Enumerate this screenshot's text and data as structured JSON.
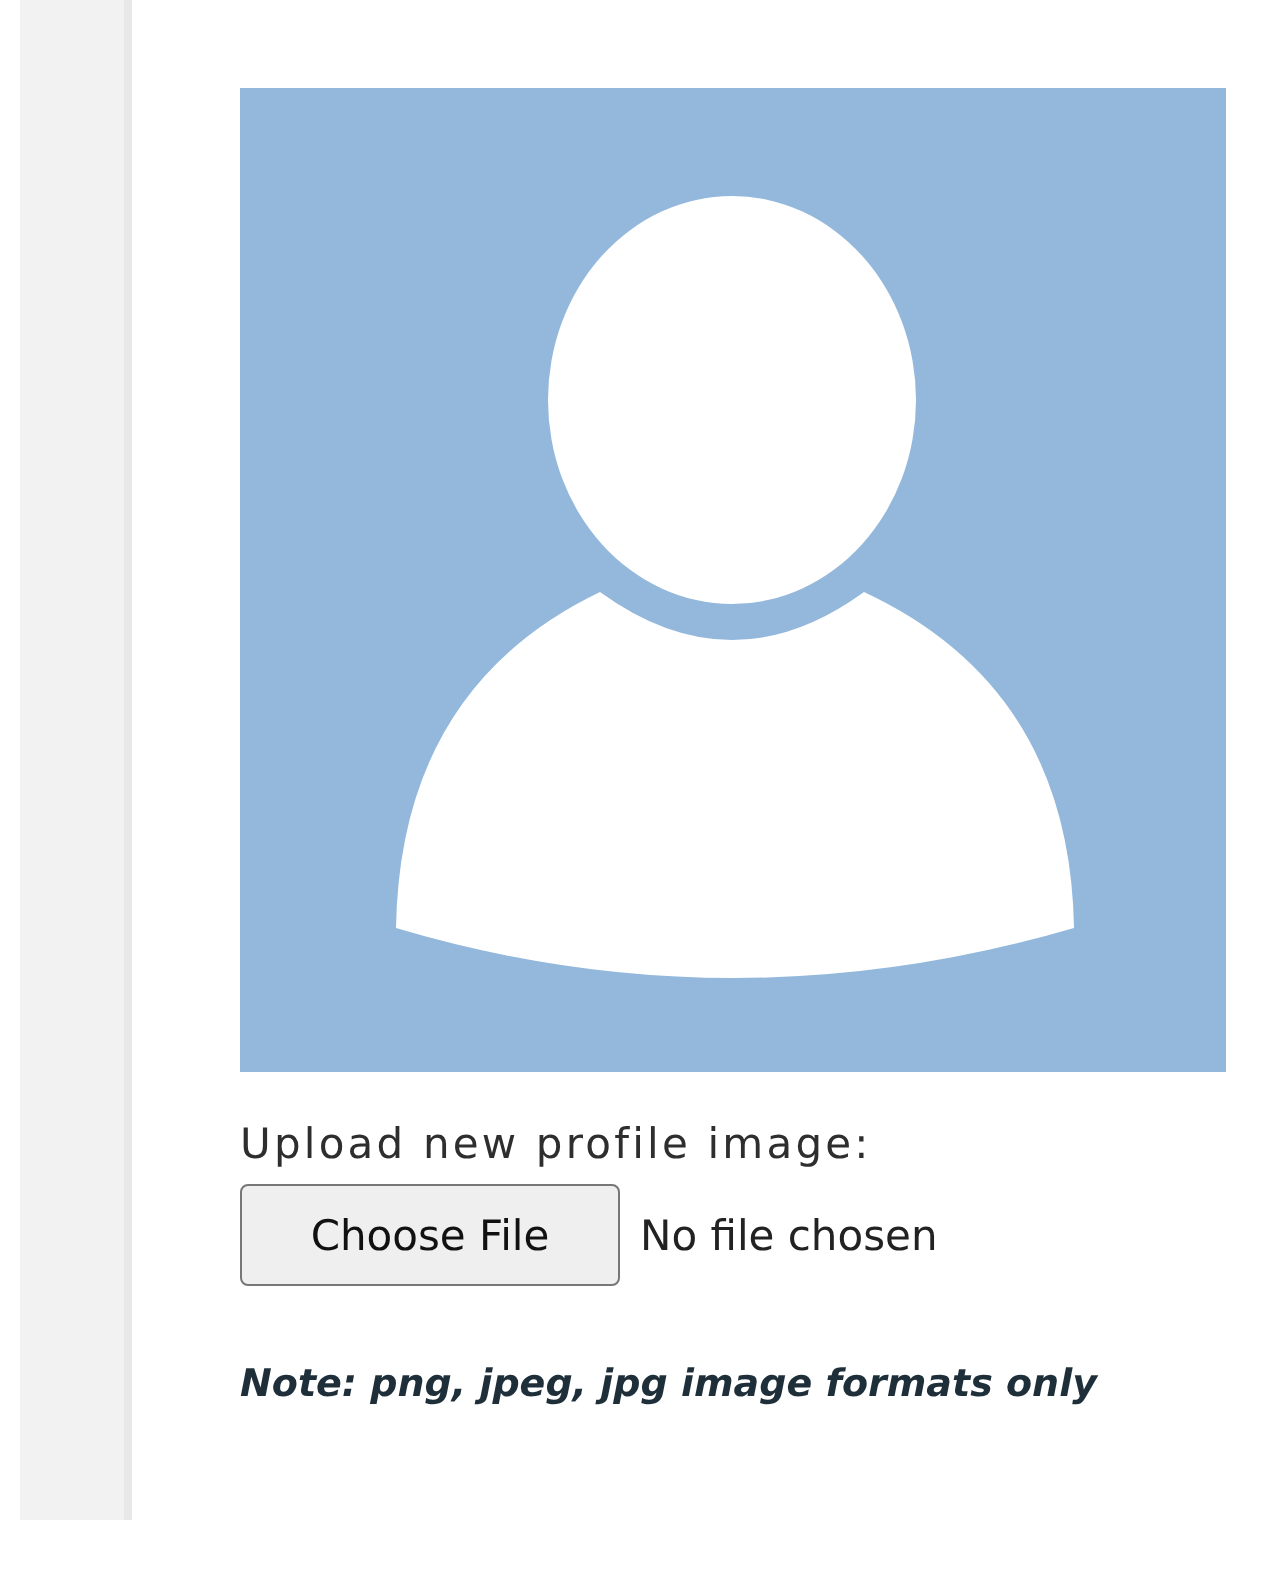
{
  "upload": {
    "label": "Upload new profile image:",
    "button": "Choose File",
    "status": "No file chosen"
  },
  "note": "Note: png, jpeg, jpg image formats only"
}
